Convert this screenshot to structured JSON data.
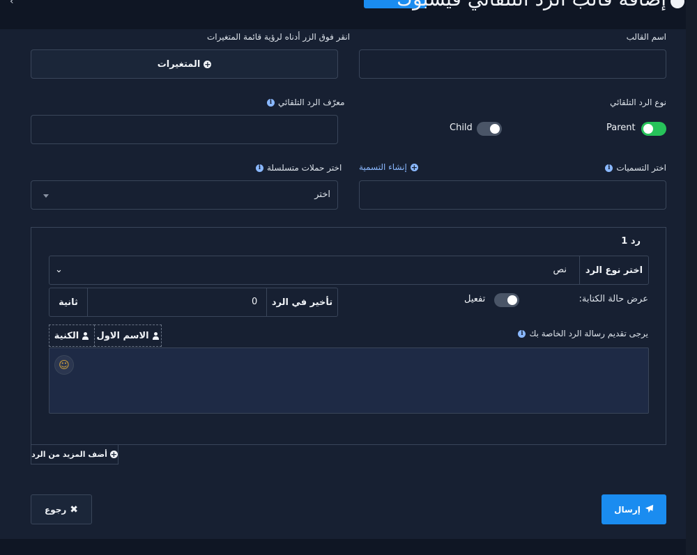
{
  "header": {
    "title": "إضافة قالب الرد التلقائي فيسبوك"
  },
  "form": {
    "template_name_label": "اسم القالب",
    "template_name_value": "",
    "variables_hint": "انقر فوق الزر أدناه لرؤية قائمة المتغيرات",
    "variables_button": "المتغيرات",
    "reply_type_label": "نوع الرد التلقائي",
    "parent_label": "Parent",
    "parent_on": true,
    "child_label": "Child",
    "child_on": false,
    "reply_id_label": "معرّف الرد التلقائي",
    "reply_id_value": "",
    "labels_label": "اختر التسميات",
    "create_label_link": "إنشاء التسمية",
    "labels_value": "",
    "sequence_label": "اختر حملات متسلسلة",
    "sequence_value": "اختر"
  },
  "reply": {
    "title": "رد 1",
    "type_label": "اختر نوع الرد",
    "type_value": "نص",
    "typing_label": "عرض حالة الكتابة:",
    "typing_toggle_label": "تفعيل",
    "typing_on": false,
    "delay_label": "تأخير في الرد",
    "delay_value": "0",
    "delay_unit": "ثانية",
    "message_label": "يرجى تقديم رسالة الرد الخاصة بك",
    "chip_first_name": "الاسم الاول",
    "chip_last_name": "الكنية",
    "message_value": ""
  },
  "actions": {
    "add_more": "أضف المزيد من الرد",
    "back": "رجوع",
    "send": "إرسال"
  },
  "colors": {
    "background": "#0f1624",
    "panel": "#172032",
    "accent": "#1a8cf0",
    "toggle_on": "#27c35a",
    "link": "#8ab8ff"
  },
  "icons": [
    "info-icon",
    "plus-circle-icon",
    "user-icon",
    "smile-icon",
    "times-icon",
    "paper-plane-icon",
    "chevron-down-icon"
  ]
}
